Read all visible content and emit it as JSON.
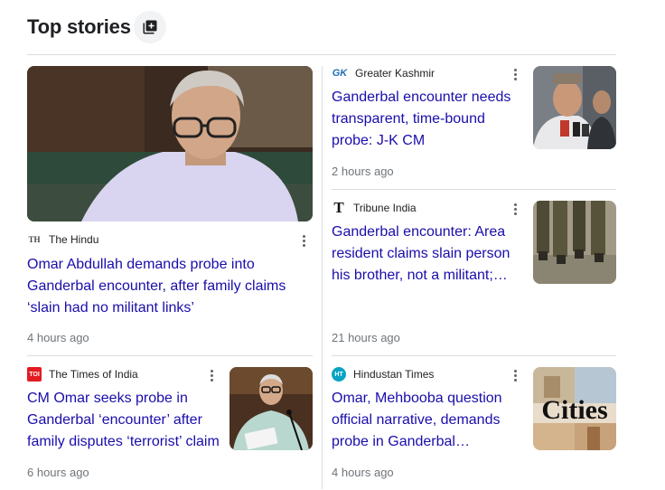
{
  "header": {
    "title": "Top stories",
    "action_icon": "add-to-collection-icon"
  },
  "stories": [
    {
      "source": "The Hindu",
      "source_logo_text": "TH",
      "headline": "Omar Abdullah demands probe into Ganderbal encounter, after family claims ‘slain had no militant links’",
      "time": "4 hours ago"
    },
    {
      "source": "Greater Kashmir",
      "source_logo_text": "GK",
      "headline": "Ganderbal encounter needs transparent, time-bound probe: J-K CM",
      "time": "2 hours ago"
    },
    {
      "source": "Tribune India",
      "source_logo_text": "T",
      "headline": "Ganderbal encounter: Area resident claims slain person his brother, not a militant; demands probe",
      "time": "21 hours ago"
    },
    {
      "source": "The Times of India",
      "source_logo_text": "TOI",
      "headline": "CM Omar seeks probe in Ganderbal ‘encounter’ after family disputes ‘terrorist’ claim",
      "time": "6 hours ago"
    },
    {
      "source": "Hindustan Times",
      "source_logo_text": "HT",
      "headline": "Omar, Mehbooba question official narrative, demands probe in Ganderbal encounter",
      "time": "4 hours ago",
      "thumb_text": "Cities"
    }
  ],
  "colors": {
    "link": "#1a0dab",
    "meta": "#70757a",
    "divider": "#dadce0",
    "toi_red": "#e21b22",
    "ht_teal": "#0aa3c2"
  }
}
